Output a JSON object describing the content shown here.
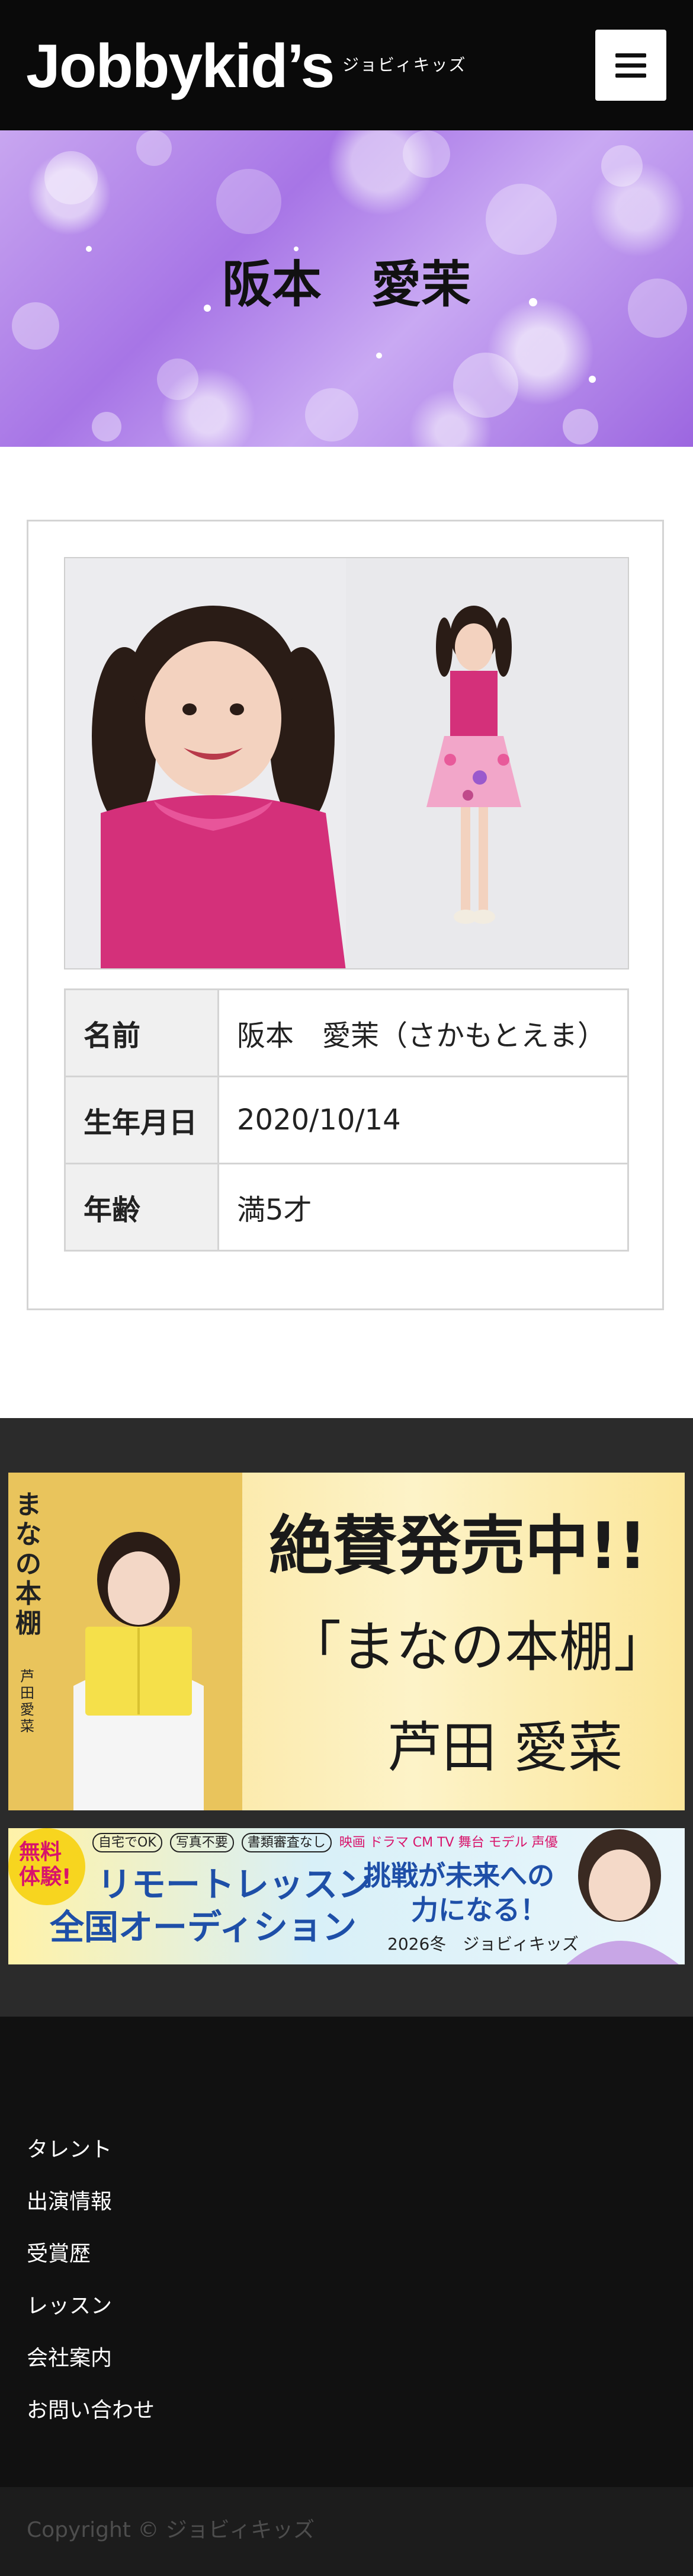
{
  "header": {
    "logo": "Jobbykid’s",
    "logo_sub": "ジョビィキッズ",
    "menu_icon": "hamburger-icon"
  },
  "hero": {
    "title": "阪本　愛茉"
  },
  "profile": {
    "rows": [
      {
        "key": "名前",
        "value": "阪本　愛茉（さかもとえま）"
      },
      {
        "key": "生年月日",
        "value": "2020/10/14"
      },
      {
        "key": "年齢",
        "value": "満5才"
      }
    ]
  },
  "banner1": {
    "book_title_vertical": "まなの本棚",
    "book_author_vertical": "芦田愛菜",
    "headline": "絶賛発売中!!",
    "title": "「まなの本棚」",
    "author": "芦田 愛菜"
  },
  "banner2": {
    "badge": "無料体験!",
    "tags": [
      "自宅でOK",
      "写真不要",
      "書類審査なし"
    ],
    "genres": "映画 ドラマ CM TV 舞台 モデル 声優",
    "line1": "リモートレッスン",
    "line2": "全国オーディション",
    "slogan1": "挑戦が未来への",
    "slogan2": "力になる！",
    "season": "2026冬　ジョビィキッズ"
  },
  "footer": {
    "links": [
      "タレント",
      "出演情報",
      "受賞歴",
      "レッスン",
      "会社案内",
      "お問い合わせ"
    ],
    "copyright": "Copyright © ジョビィキッズ"
  },
  "colors": {
    "header_bg": "#0a0a0a",
    "hero_purple": "#a775e6",
    "footer_bg": "#111111",
    "banner_area_bg": "#2b2b2b"
  }
}
